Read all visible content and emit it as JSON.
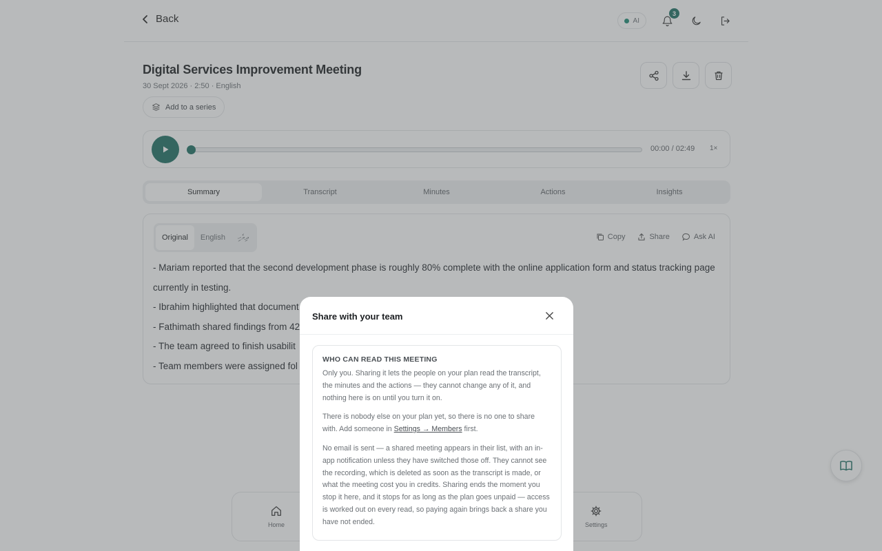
{
  "header": {
    "back_label": "Back",
    "ai_label": "AI",
    "notification_count": "3"
  },
  "meeting": {
    "title": "Digital Services Improvement Meeting",
    "meta": "30 Sept 2026 · 2:50 · English",
    "series_label": "Add to a series"
  },
  "player": {
    "time": "00:00 / 02:49",
    "speed": "1×",
    "progress": 0
  },
  "tabs": [
    {
      "label": "Summary",
      "active": true
    },
    {
      "label": "Transcript",
      "active": false
    },
    {
      "label": "Minutes",
      "active": false
    },
    {
      "label": "Actions",
      "active": false
    },
    {
      "label": "Insights",
      "active": false
    }
  ],
  "summary": {
    "languages": [
      "Original",
      "English",
      "ދިވެހި"
    ],
    "tools": {
      "copy": "Copy",
      "share": "Share",
      "ask_ai": "Ask AI"
    },
    "bullets": [
      "- Mariam reported that the second development phase is roughly 80% complete with the online application form and status tracking page currently in testing.",
      "- Ibrahim highlighted that document",
      "- Fathimath shared findings from 42",
      "- The team agreed to finish usabilit",
      "- Team members were assigned fol"
    ]
  },
  "bottom_nav": {
    "home": "Home",
    "settings": "Settings"
  },
  "modal": {
    "title": "Share with your team",
    "section_heading": "WHO CAN READ THIS MEETING",
    "para1": "Only you. Sharing it lets the people on your plan read the transcript, the minutes and the actions — they cannot change any of it, and nothing here is on until you turn it on.",
    "para2_before": "There is nobody else on your plan yet, so there is no one to share with. Add someone in ",
    "para2_link": "Settings → Members",
    "para2_after": " first.",
    "para3": "No email is sent — a shared meeting appears in their list, with an in-app notification unless they have switched those off. They cannot see the recording, which is deleted as soon as the transcript is made, or what the meeting cost you in credits. Sharing ends the moment you stop it here, and it stops for as long as the plan goes unpaid — access is worked out on every read, so paying again brings back a share you have not ended."
  },
  "colors": {
    "accent": "#1d6e63",
    "overlay": "#565a5e"
  }
}
